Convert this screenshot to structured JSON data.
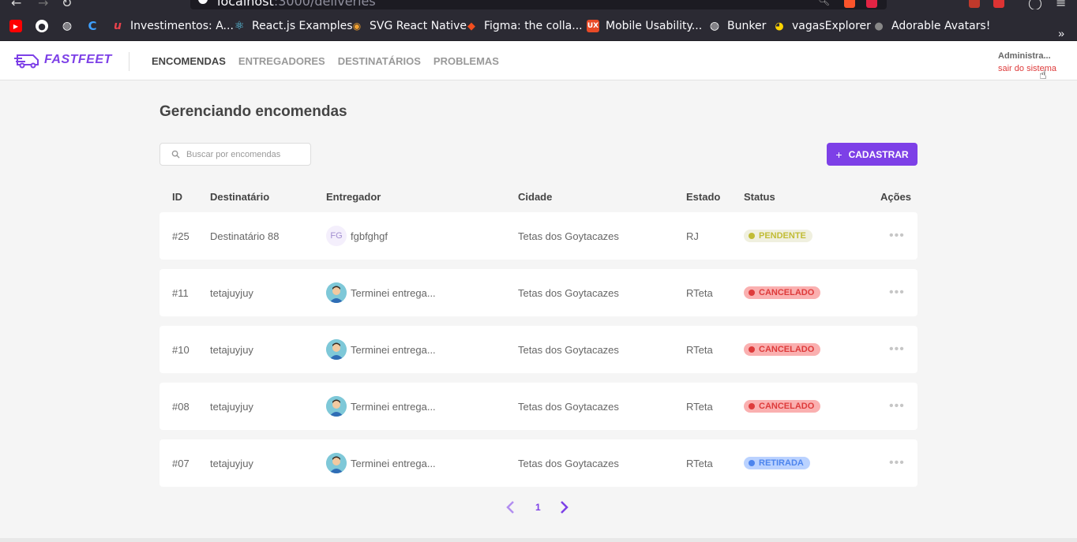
{
  "browser": {
    "url_host": "localhost",
    "url_rest": ":3000/deliveries",
    "bookmarks": [
      {
        "label": "",
        "icon": "youtube-icon",
        "color": "#ff0000"
      },
      {
        "label": "",
        "icon": "github-icon",
        "color": "#ffffff"
      },
      {
        "label": "",
        "icon": "globe-icon",
        "color": "#ffffff"
      },
      {
        "label": "",
        "icon": "c-logo-icon",
        "color": "#3ea0ff"
      },
      {
        "label": "Investimentos: A...",
        "icon": "u-logo-icon",
        "color": "#e8424c"
      },
      {
        "label": "React.js Examples",
        "icon": "react-icon",
        "color": "#61dafb"
      },
      {
        "label": "SVG React Native",
        "icon": "eye-icon",
        "color": "#f0a030"
      },
      {
        "label": "Figma: the colla...",
        "icon": "figma-icon",
        "color": "#f24e1e"
      },
      {
        "label": "Mobile Usability...",
        "icon": "ux-icon",
        "color": "#e84a27"
      },
      {
        "label": "Bunker",
        "icon": "globe-icon",
        "color": "#ffffff"
      },
      {
        "label": "vagasExplorer",
        "icon": "pacman-icon",
        "color": "#ffd400"
      },
      {
        "label": "Adorable Avatars!",
        "icon": "person-icon",
        "color": "#888888"
      }
    ],
    "more": "»"
  },
  "header": {
    "logo": "FASTFEET",
    "nav": [
      {
        "label": "ENCOMENDAS",
        "active": true
      },
      {
        "label": "ENTREGADORES",
        "active": false
      },
      {
        "label": "DESTINATÁRIOS",
        "active": false
      },
      {
        "label": "PROBLEMAS",
        "active": false
      }
    ],
    "user_name": "Administra...",
    "logout": "sair do sistema"
  },
  "main": {
    "title": "Gerenciando encomendas",
    "search_placeholder": "Buscar por encomendas",
    "add_button": "CADASTRAR",
    "columns": [
      "ID",
      "Destinatário",
      "Entregador",
      "Cidade",
      "Estado",
      "Status",
      "Ações"
    ],
    "rows": [
      {
        "id": "#25",
        "recipient": "Destinatário 88",
        "courier_initials": "FG",
        "courier": "fgbfghgf",
        "city": "Tetas dos Goytacazes",
        "state": "RJ",
        "status": "PENDENTE",
        "status_kind": "pendente"
      },
      {
        "id": "#11",
        "recipient": "tetajuyjuy",
        "courier_initials": "",
        "courier": "Terminei entrega...",
        "city": "Tetas dos Goytacazes",
        "state": "RTeta",
        "status": "CANCELADO",
        "status_kind": "cancelado"
      },
      {
        "id": "#10",
        "recipient": "tetajuyjuy",
        "courier_initials": "",
        "courier": "Terminei entrega...",
        "city": "Tetas dos Goytacazes",
        "state": "RTeta",
        "status": "CANCELADO",
        "status_kind": "cancelado"
      },
      {
        "id": "#08",
        "recipient": "tetajuyjuy",
        "courier_initials": "",
        "courier": "Terminei entrega...",
        "city": "Tetas dos Goytacazes",
        "state": "RTeta",
        "status": "CANCELADO",
        "status_kind": "cancelado"
      },
      {
        "id": "#07",
        "recipient": "tetajuyjuy",
        "courier_initials": "",
        "courier": "Terminei entrega...",
        "city": "Tetas dos Goytacazes",
        "state": "RTeta",
        "status": "RETIRADA",
        "status_kind": "retirada"
      }
    ],
    "actions_icon": "more-horizontal-icon",
    "pagination": {
      "page": "1",
      "prev_icon": "chevron-left-icon",
      "next_icon": "chevron-right-icon"
    }
  },
  "colors": {
    "brand": "#7d40e7",
    "logout": "#de3b3b"
  }
}
